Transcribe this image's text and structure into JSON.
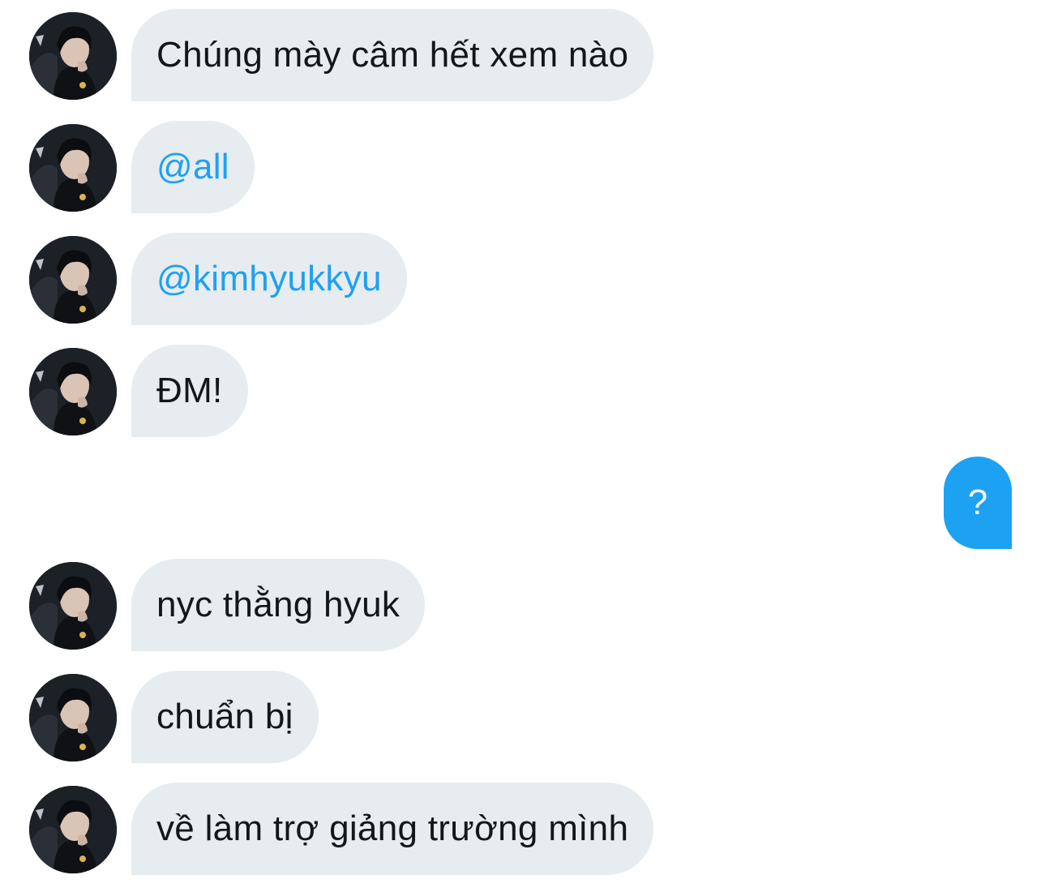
{
  "conversation": {
    "incoming": [
      {
        "text": "Chúng mày câm hết xem nào",
        "type": "text"
      },
      {
        "text": "@all",
        "type": "mention"
      },
      {
        "text": "@kimhyukkyu",
        "type": "mention"
      },
      {
        "text": "ĐM!",
        "type": "text"
      },
      {
        "text": "nyc thằng hyuk",
        "type": "text"
      },
      {
        "text": "chuẩn bị",
        "type": "text"
      },
      {
        "text": "về làm trợ giảng trường mình",
        "type": "text"
      }
    ],
    "outgoing": [
      {
        "text": "?"
      }
    ]
  },
  "colors": {
    "incoming_bubble": "#e6ecf0",
    "incoming_text": "#14171a",
    "mention_text": "#1da1f2",
    "outgoing_bubble": "#1da1f2",
    "outgoing_text": "#ffffff"
  },
  "icons": {
    "avatar": "profile-photo"
  }
}
